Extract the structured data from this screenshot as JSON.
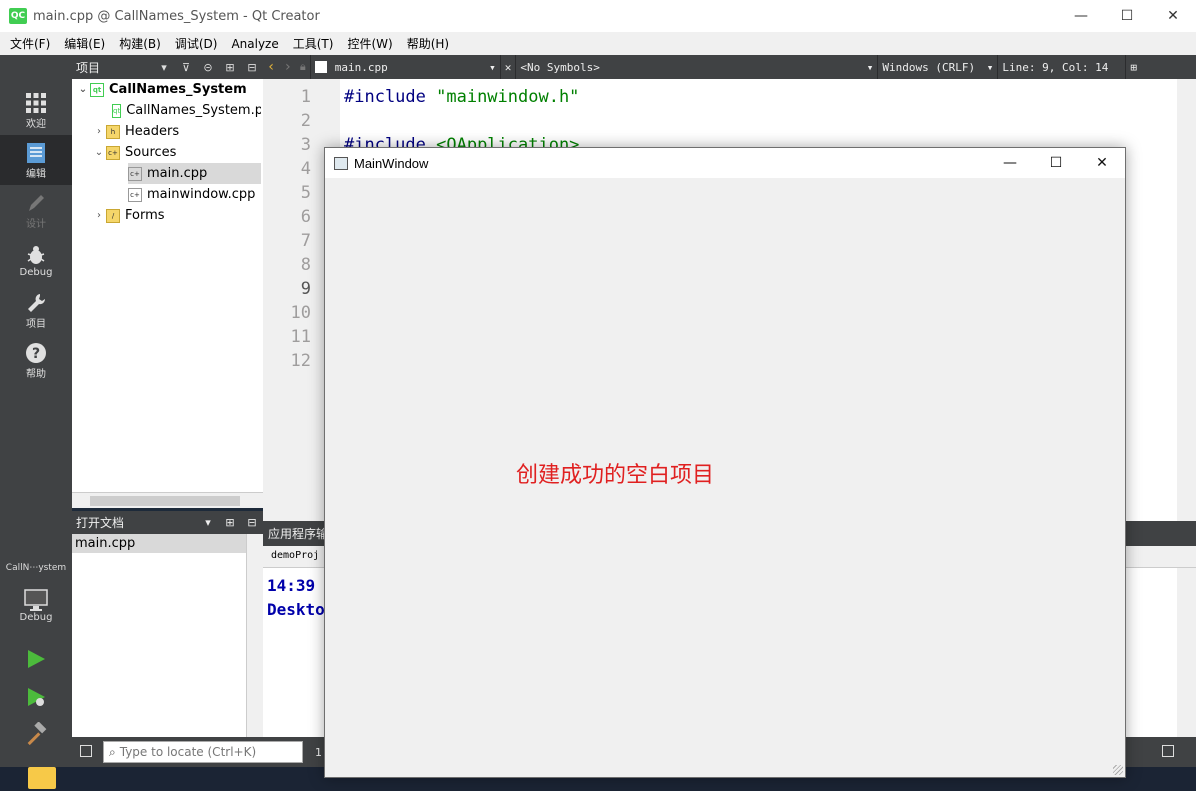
{
  "window": {
    "title": "main.cpp @ CallNames_System - Qt Creator",
    "logo_text": "QC",
    "minimize": "—",
    "maximize": "☐",
    "close": "✕"
  },
  "menubar": {
    "items": [
      "文件(F)",
      "编辑(E)",
      "构建(B)",
      "调试(D)",
      "Analyze",
      "工具(T)",
      "控件(W)",
      "帮助(H)"
    ]
  },
  "modes": [
    {
      "label": "欢迎",
      "icon": "grid-icon"
    },
    {
      "label": "编辑",
      "icon": "edit-icon"
    },
    {
      "label": "设计",
      "icon": "pen-icon"
    },
    {
      "label": "Debug",
      "icon": "bug-icon"
    },
    {
      "label": "项目",
      "icon": "wrench-icon"
    },
    {
      "label": "帮助",
      "icon": "help-icon"
    }
  ],
  "kit": {
    "project_label": "CallN⋯ystem",
    "build_label": "Debug"
  },
  "project_panel": {
    "title": "项目",
    "tree": [
      {
        "label": "CallNames_System",
        "arrow": "⌄",
        "icon": "qt-project-icon",
        "bold": true
      },
      {
        "label": "CallNames_System.pro",
        "arrow": "",
        "icon": "pro-file-icon"
      },
      {
        "label": "Headers",
        "arrow": "›",
        "icon": "headers-folder-icon"
      },
      {
        "label": "Sources",
        "arrow": "⌄",
        "icon": "sources-folder-icon"
      },
      {
        "label": "main.cpp",
        "arrow": "",
        "icon": "cpp-file-icon",
        "selected": true
      },
      {
        "label": "mainwindow.cpp",
        "arrow": "",
        "icon": "cpp-file-icon"
      },
      {
        "label": "Forms",
        "arrow": "›",
        "icon": "forms-folder-icon"
      }
    ]
  },
  "open_docs": {
    "title": "打开文档",
    "items": [
      "main.cpp"
    ]
  },
  "editor_toolbar": {
    "file": "main.cpp",
    "symbols": "<No Symbols>",
    "line_ending": "Windows (CRLF)",
    "position": "Line: 9, Col: 14"
  },
  "editor": {
    "line_numbers": [
      "1",
      "2",
      "3",
      "4",
      "5",
      "6",
      "7",
      "8",
      "9",
      "10",
      "11",
      "12"
    ],
    "current_line": "9",
    "code": [
      {
        "kw": "#include",
        "arg": " \"mainwindow.h\""
      },
      {
        "kw": "",
        "arg": ""
      },
      {
        "kw": "#include",
        "arg": " <QApplication>"
      }
    ]
  },
  "output": {
    "title": "应用程序输",
    "subtab": "demoProj",
    "lines": [
      "14:39",
      "Deskto"
    ]
  },
  "statusbar": {
    "locate_placeholder": "Type to locate (Ctrl+K)",
    "pane_number": "1"
  },
  "main_window": {
    "title": "MainWindow",
    "center_text": "创建成功的空白项目",
    "minimize": "—",
    "maximize": "☐",
    "close": "✕"
  },
  "colors": {
    "qt_green": "#41cd52",
    "sidebar": "#404244",
    "center_text": "#e02020",
    "output_text": "#0000aa"
  }
}
